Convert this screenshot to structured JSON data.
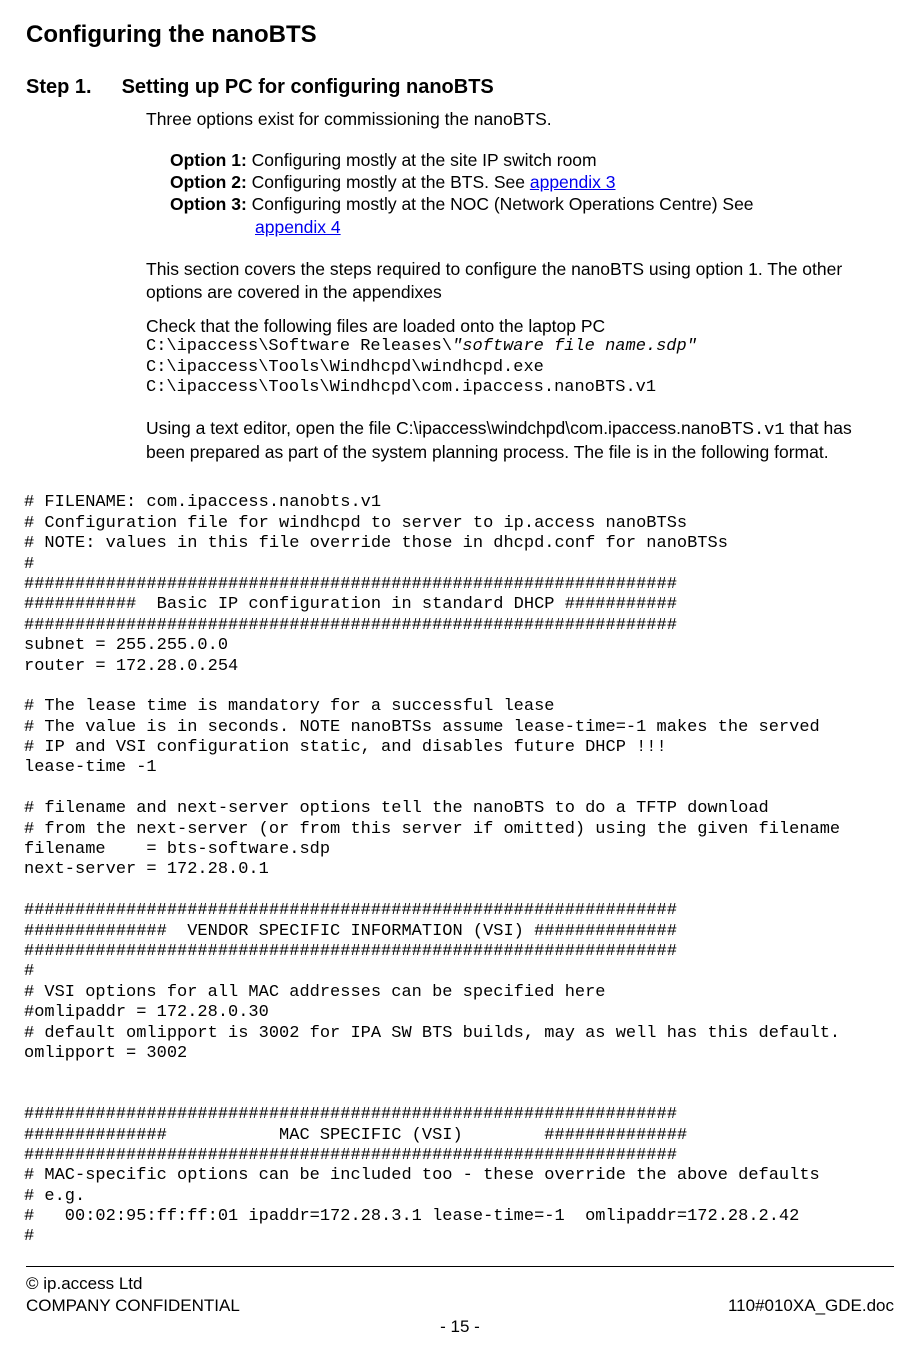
{
  "heading": "Configuring the nanoBTS",
  "step_label": "Step 1.",
  "step_title": "Setting up PC for configuring nanoBTS",
  "intro_line": "Three options exist for commissioning the nanoBTS.",
  "options": {
    "opt1_label": "Option 1:",
    "opt1_text": " Configuring mostly at the site IP switch room",
    "opt2_label": "Option 2:",
    "opt2_text": " Configuring mostly at the BTS. See ",
    "opt2_link": "appendix 3",
    "opt3_label": "Option 3:",
    "opt3_text": " Configuring mostly at the NOC (Network Operations Centre) See",
    "opt3_link": "appendix 4"
  },
  "section_para": "This section covers the steps required to configure the nanoBTS using option 1. The other options are covered in the appendixes",
  "check_line": "Check that the following files are loaded onto the laptop PC",
  "paths": {
    "p1_prefix": "C:\\ipaccess\\Software Releases\\",
    "p1_italic": "\"software file name.sdp\"",
    "p2": "C:\\ipaccess\\Tools\\Windhcpd\\windhcpd.exe",
    "p3": "C:\\ipaccess\\Tools\\Windhcpd\\com.ipaccess.nanoBTS.v1"
  },
  "editor_para_prefix": "Using a text editor, open the file C:\\ipaccess\\windchpd\\com.ipaccess.nanoBTS",
  "editor_para_mono": ".v1",
  "editor_para_rest": "that has been prepared as part of the system planning process. The file is in the following format.",
  "config_file": "# FILENAME: com.ipaccess.nanobts.v1\n# Configuration file for windhcpd to server to ip.access nanoBTSs\n# NOTE: values in this file override those in dhcpd.conf for nanoBTSs\n#\n################################################################\n###########  Basic IP configuration in standard DHCP ###########\n################################################################\nsubnet = 255.255.0.0\nrouter = 172.28.0.254\n\n# The lease time is mandatory for a successful lease\n# The value is in seconds. NOTE nanoBTSs assume lease-time=-1 makes the served\n# IP and VSI configuration static, and disables future DHCP !!!\nlease-time -1\n\n# filename and next-server options tell the nanoBTS to do a TFTP download\n# from the next-server (or from this server if omitted) using the given filename\nfilename    = bts-software.sdp\nnext-server = 172.28.0.1\n\n################################################################\n##############  VENDOR SPECIFIC INFORMATION (VSI) ##############\n################################################################\n#\n# VSI options for all MAC addresses can be specified here\n#omlipaddr = 172.28.0.30\n# default omlipport is 3002 for IPA SW BTS builds, may as well has this default.\nomlipport = 3002\n\n\n################################################################\n##############           MAC SPECIFIC (VSI)        ##############\n################################################################\n# MAC-specific options can be included too - these override the above defaults\n# e.g.\n#   00:02:95:ff:ff:01 ipaddr=172.28.3.1 lease-time=-1  omlipaddr=172.28.2.42\n#",
  "footer": {
    "copyright": "© ip.access Ltd",
    "confidential": "COMPANY CONFIDENTIAL",
    "doc_id": "110#010XA_GDE.doc",
    "page": "- 15 -"
  }
}
